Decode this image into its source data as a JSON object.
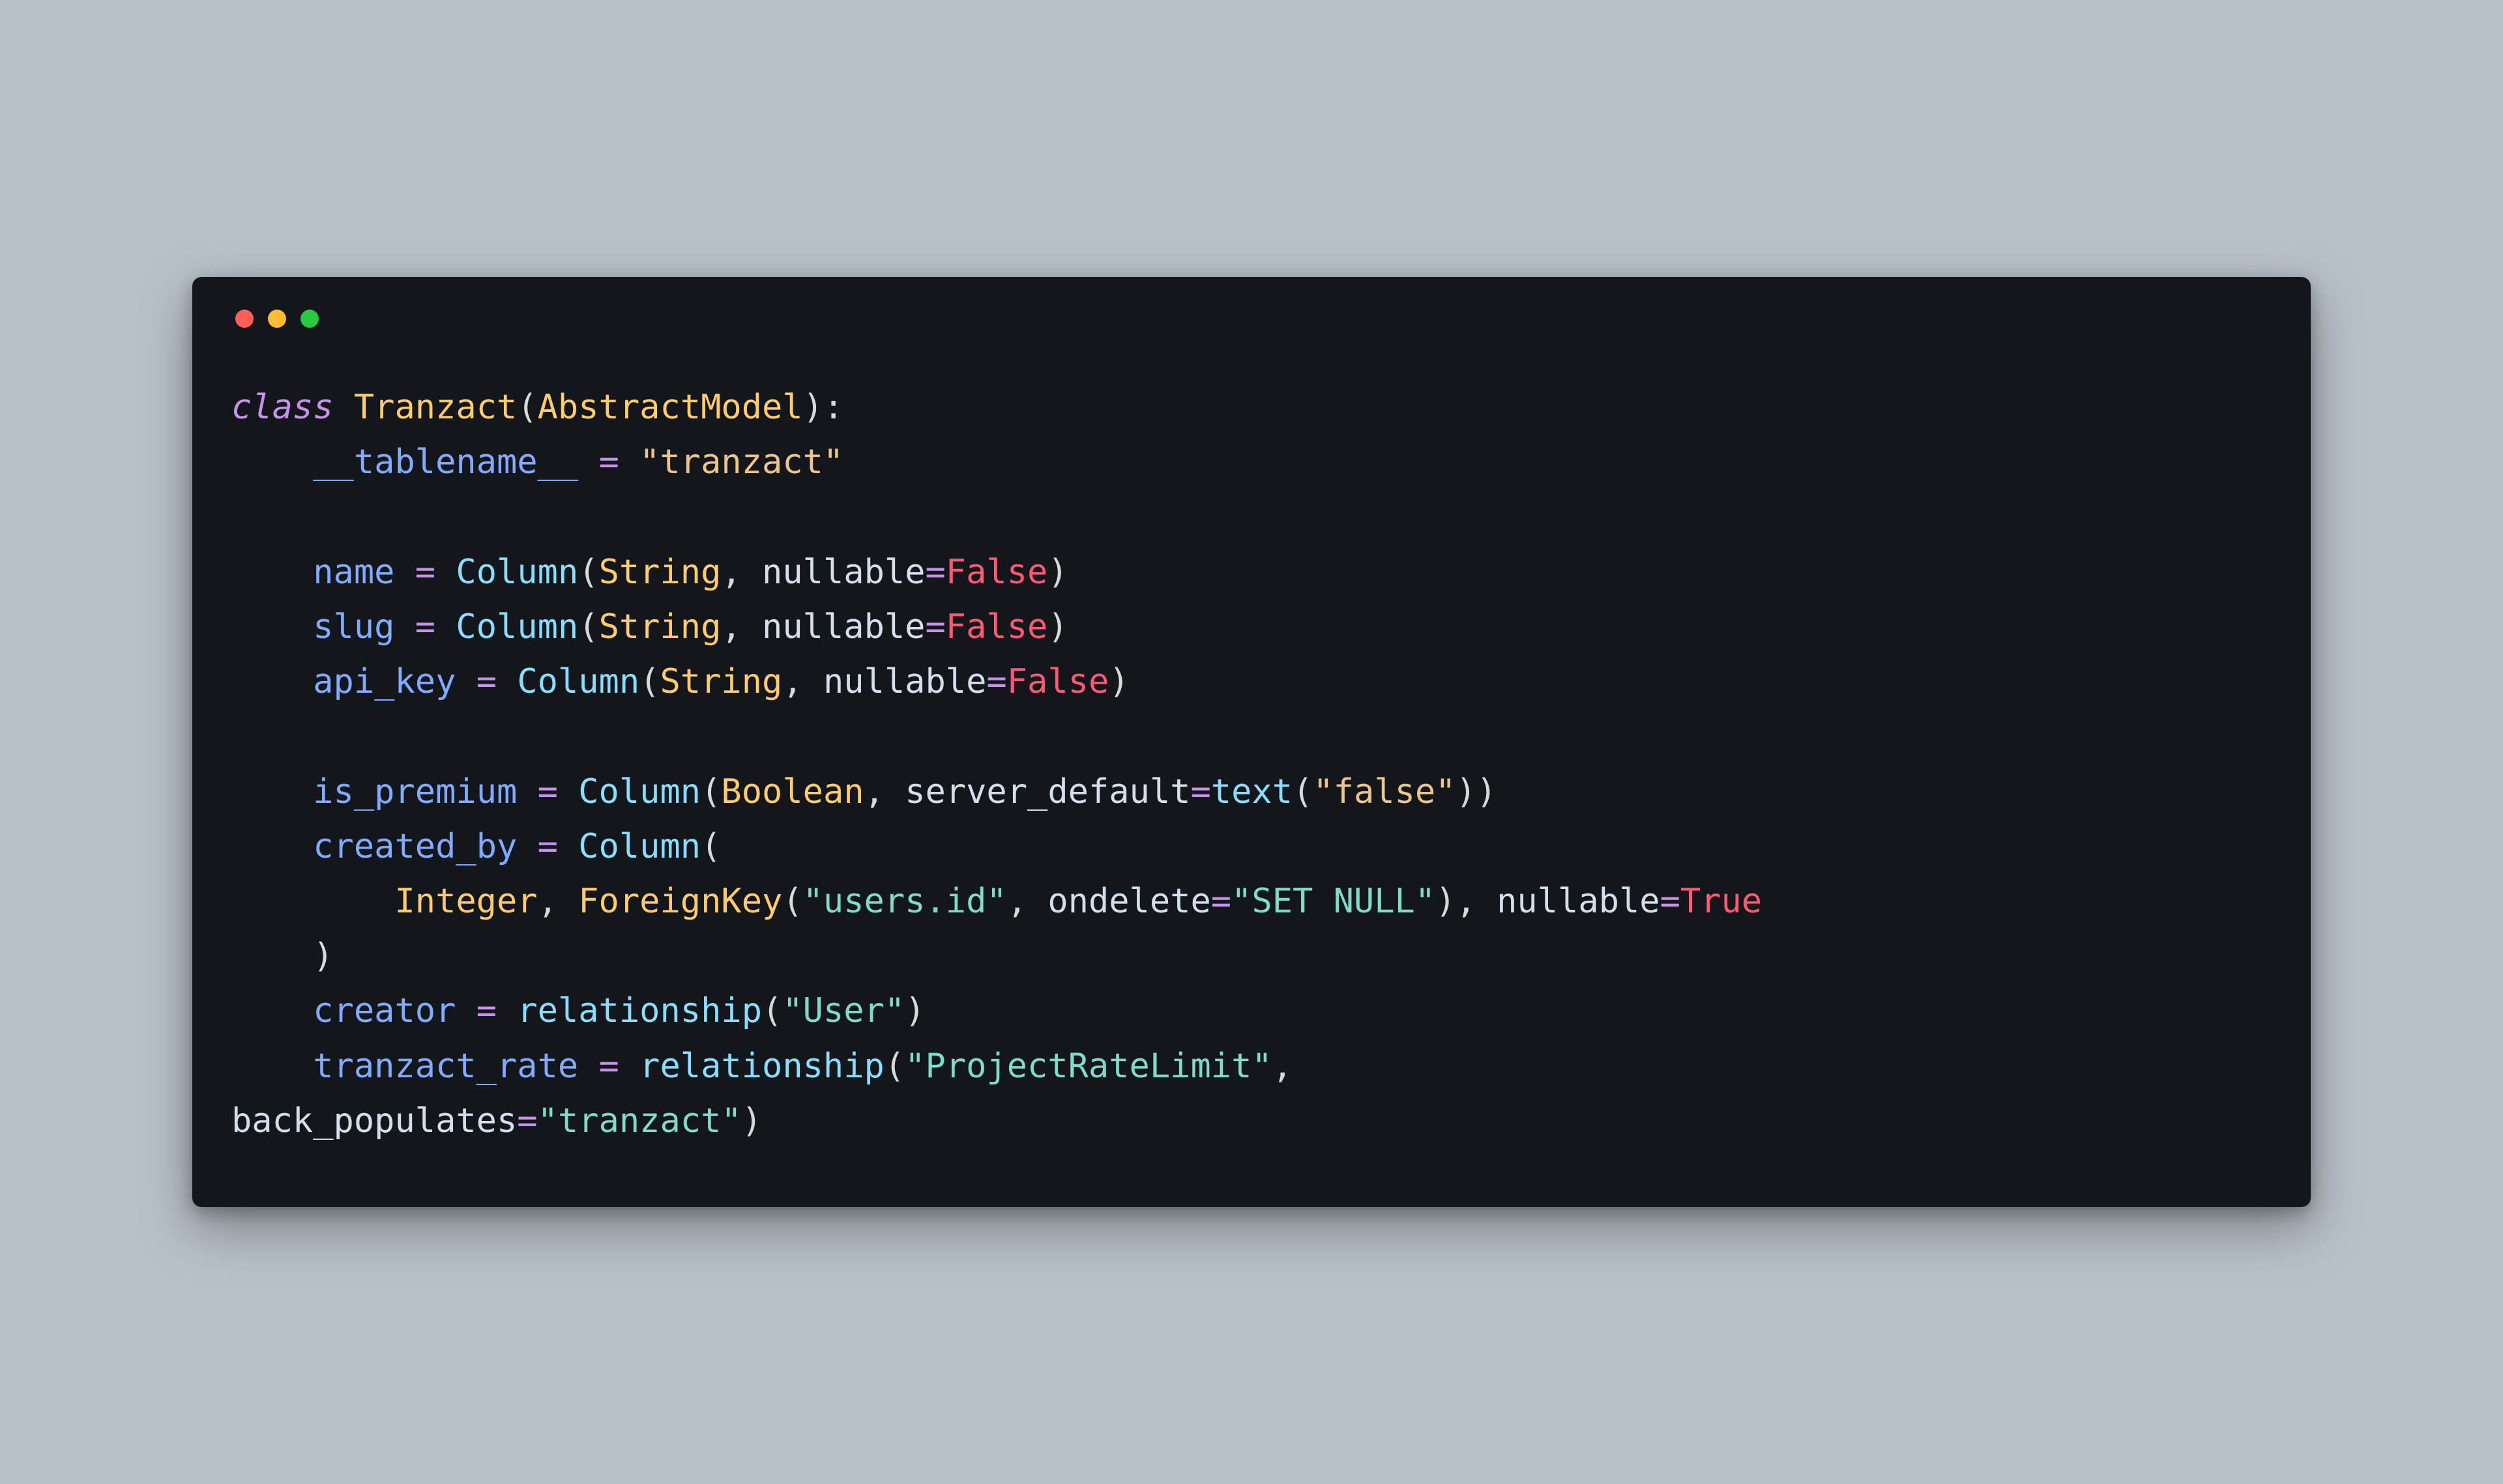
{
  "colors": {
    "page_bg": "#b8c0c8",
    "window_bg": "#13161a",
    "traffic_red": "#ff5f56",
    "traffic_yellow": "#ffbd2e",
    "traffic_green": "#27c93f"
  },
  "source_language": "python",
  "code": {
    "keyword_class": "class",
    "class_name": "Tranzact",
    "base_class": "AbstractModel",
    "dunder_tablename": "__tablename__",
    "tablename_value": "\"tranzact\"",
    "attr_name": "name",
    "attr_slug": "slug",
    "attr_api_key": "api_key",
    "attr_is_premium": "is_premium",
    "attr_created_by": "created_by",
    "attr_creator": "creator",
    "attr_tranzact_rate": "tranzact_rate",
    "fn_column": "Column",
    "fn_relationship": "relationship",
    "fn_text": "text",
    "fn_foreignkey": "ForeignKey",
    "type_string": "String",
    "type_boolean": "Boolean",
    "type_integer": "Integer",
    "kw_nullable": "nullable",
    "kw_server_default": "server_default",
    "kw_ondelete": "ondelete",
    "kw_back_populates": "back_populates",
    "bool_false": "False",
    "bool_true": "True",
    "str_false": "\"false\"",
    "str_users_id": "\"users.id\"",
    "str_set_null": "\"SET NULL\"",
    "str_user": "\"User\"",
    "str_project_rate_limit": "\"ProjectRateLimit\"",
    "str_tranzact2": "\"tranzact\"",
    "eq": "=",
    "lp": "(",
    "rp": ")",
    "colon": ":",
    "comma": ","
  }
}
